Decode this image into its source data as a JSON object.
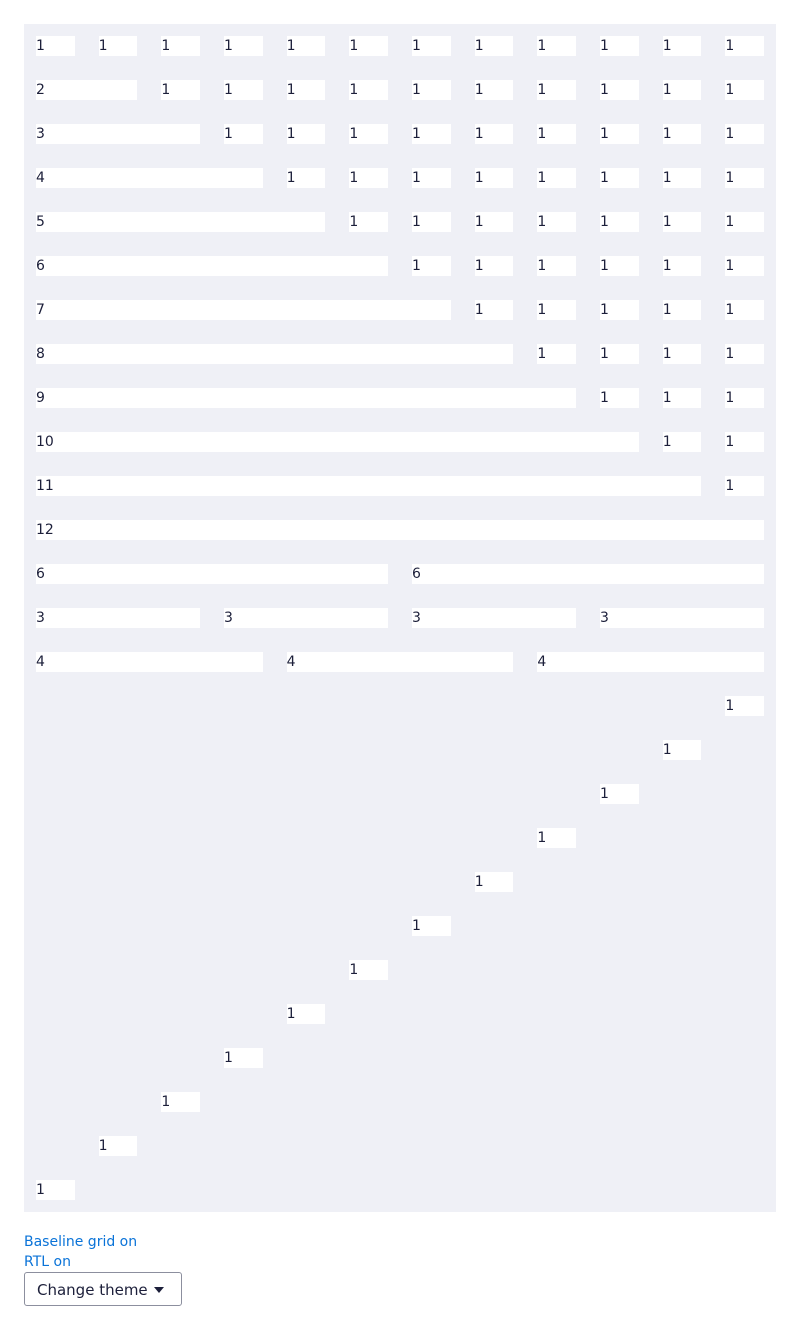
{
  "grid": {
    "columns": 12,
    "rows": [
      {
        "cells": [
          {
            "label": "1",
            "span": 1
          },
          {
            "label": "1",
            "span": 1
          },
          {
            "label": "1",
            "span": 1
          },
          {
            "label": "1",
            "span": 1
          },
          {
            "label": "1",
            "span": 1
          },
          {
            "label": "1",
            "span": 1
          },
          {
            "label": "1",
            "span": 1
          },
          {
            "label": "1",
            "span": 1
          },
          {
            "label": "1",
            "span": 1
          },
          {
            "label": "1",
            "span": 1
          },
          {
            "label": "1",
            "span": 1
          },
          {
            "label": "1",
            "span": 1
          }
        ]
      },
      {
        "cells": [
          {
            "label": "2",
            "span": 2
          },
          {
            "label": "1",
            "span": 1
          },
          {
            "label": "1",
            "span": 1
          },
          {
            "label": "1",
            "span": 1
          },
          {
            "label": "1",
            "span": 1
          },
          {
            "label": "1",
            "span": 1
          },
          {
            "label": "1",
            "span": 1
          },
          {
            "label": "1",
            "span": 1
          },
          {
            "label": "1",
            "span": 1
          },
          {
            "label": "1",
            "span": 1
          },
          {
            "label": "1",
            "span": 1
          }
        ]
      },
      {
        "cells": [
          {
            "label": "3",
            "span": 3
          },
          {
            "label": "1",
            "span": 1
          },
          {
            "label": "1",
            "span": 1
          },
          {
            "label": "1",
            "span": 1
          },
          {
            "label": "1",
            "span": 1
          },
          {
            "label": "1",
            "span": 1
          },
          {
            "label": "1",
            "span": 1
          },
          {
            "label": "1",
            "span": 1
          },
          {
            "label": "1",
            "span": 1
          },
          {
            "label": "1",
            "span": 1
          }
        ]
      },
      {
        "cells": [
          {
            "label": "4",
            "span": 4
          },
          {
            "label": "1",
            "span": 1
          },
          {
            "label": "1",
            "span": 1
          },
          {
            "label": "1",
            "span": 1
          },
          {
            "label": "1",
            "span": 1
          },
          {
            "label": "1",
            "span": 1
          },
          {
            "label": "1",
            "span": 1
          },
          {
            "label": "1",
            "span": 1
          },
          {
            "label": "1",
            "span": 1
          }
        ]
      },
      {
        "cells": [
          {
            "label": "5",
            "span": 5
          },
          {
            "label": "1",
            "span": 1
          },
          {
            "label": "1",
            "span": 1
          },
          {
            "label": "1",
            "span": 1
          },
          {
            "label": "1",
            "span": 1
          },
          {
            "label": "1",
            "span": 1
          },
          {
            "label": "1",
            "span": 1
          },
          {
            "label": "1",
            "span": 1
          }
        ]
      },
      {
        "cells": [
          {
            "label": "6",
            "span": 6
          },
          {
            "label": "1",
            "span": 1
          },
          {
            "label": "1",
            "span": 1
          },
          {
            "label": "1",
            "span": 1
          },
          {
            "label": "1",
            "span": 1
          },
          {
            "label": "1",
            "span": 1
          },
          {
            "label": "1",
            "span": 1
          }
        ]
      },
      {
        "cells": [
          {
            "label": "7",
            "span": 7
          },
          {
            "label": "1",
            "span": 1
          },
          {
            "label": "1",
            "span": 1
          },
          {
            "label": "1",
            "span": 1
          },
          {
            "label": "1",
            "span": 1
          },
          {
            "label": "1",
            "span": 1
          }
        ]
      },
      {
        "cells": [
          {
            "label": "8",
            "span": 8
          },
          {
            "label": "1",
            "span": 1
          },
          {
            "label": "1",
            "span": 1
          },
          {
            "label": "1",
            "span": 1
          },
          {
            "label": "1",
            "span": 1
          }
        ]
      },
      {
        "cells": [
          {
            "label": "9",
            "span": 9
          },
          {
            "label": "1",
            "span": 1
          },
          {
            "label": "1",
            "span": 1
          },
          {
            "label": "1",
            "span": 1
          }
        ]
      },
      {
        "cells": [
          {
            "label": "10",
            "span": 10
          },
          {
            "label": "1",
            "span": 1
          },
          {
            "label": "1",
            "span": 1
          }
        ]
      },
      {
        "cells": [
          {
            "label": "11",
            "span": 11
          },
          {
            "label": "1",
            "span": 1
          }
        ]
      },
      {
        "cells": [
          {
            "label": "12",
            "span": 12
          }
        ]
      },
      {
        "cells": [
          {
            "label": "6",
            "span": 6
          },
          {
            "label": "6",
            "span": 6
          }
        ]
      },
      {
        "cells": [
          {
            "label": "3",
            "span": 3
          },
          {
            "label": "3",
            "span": 3
          },
          {
            "label": "3",
            "span": 3
          },
          {
            "label": "3",
            "span": 3
          }
        ]
      },
      {
        "cells": [
          {
            "label": "4",
            "span": 4
          },
          {
            "label": "4",
            "span": 4
          },
          {
            "label": "4",
            "span": 4
          }
        ]
      },
      {
        "cells": [
          {
            "label": "1",
            "span": 1,
            "start": 12
          }
        ]
      },
      {
        "cells": [
          {
            "label": "1",
            "span": 1,
            "start": 11
          }
        ]
      },
      {
        "cells": [
          {
            "label": "1",
            "span": 1,
            "start": 10
          }
        ]
      },
      {
        "cells": [
          {
            "label": "1",
            "span": 1,
            "start": 9
          }
        ]
      },
      {
        "cells": [
          {
            "label": "1",
            "span": 1,
            "start": 8
          }
        ]
      },
      {
        "cells": [
          {
            "label": "1",
            "span": 1,
            "start": 7
          }
        ]
      },
      {
        "cells": [
          {
            "label": "1",
            "span": 1,
            "start": 6
          }
        ]
      },
      {
        "cells": [
          {
            "label": "1",
            "span": 1,
            "start": 5
          }
        ]
      },
      {
        "cells": [
          {
            "label": "1",
            "span": 1,
            "start": 4
          }
        ]
      },
      {
        "cells": [
          {
            "label": "1",
            "span": 1,
            "start": 3
          }
        ]
      },
      {
        "cells": [
          {
            "label": "1",
            "span": 1,
            "start": 2
          }
        ]
      },
      {
        "cells": [
          {
            "label": "1",
            "span": 1,
            "start": 1
          }
        ]
      }
    ]
  },
  "controls": {
    "baseline_grid_label": "Baseline grid on",
    "rtl_label": "RTL on",
    "theme_select_label": "Change theme"
  },
  "colors": {
    "panel_background": "#eff0f6",
    "cell_background": "#ffffff",
    "link": "#0a73d8",
    "text": "#1c1f3a"
  }
}
